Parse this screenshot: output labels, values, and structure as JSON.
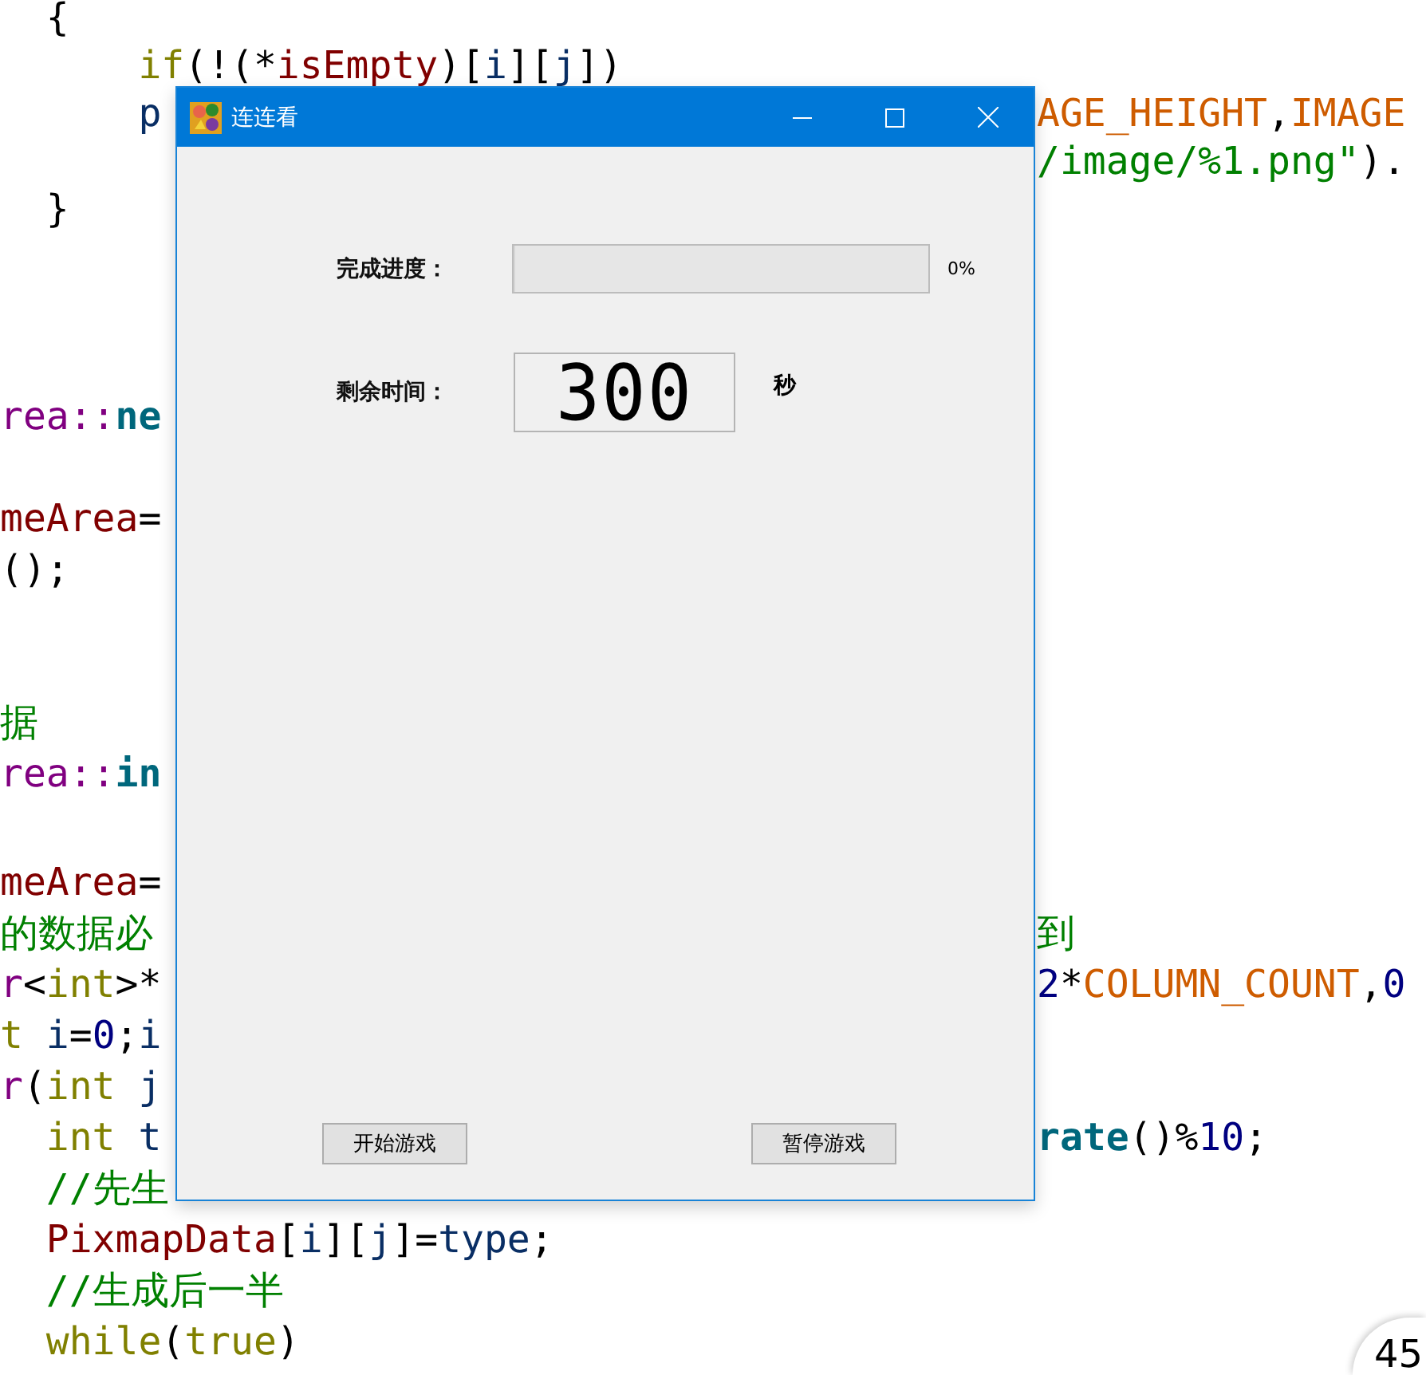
{
  "editor": {
    "blocks": [
      [
        {
          "left": [
            {
              "kind": "punct",
              "text": "  {"
            }
          ]
        },
        {
          "left": [
            {
              "kind": "keyword",
              "text": "      if"
            },
            {
              "kind": "punct",
              "text": "(!(*"
            },
            {
              "kind": "member",
              "text": "isEmpty"
            },
            {
              "kind": "punct",
              "text": ")["
            },
            {
              "kind": "local",
              "text": "i"
            },
            {
              "kind": "punct",
              "text": "]["
            },
            {
              "kind": "local",
              "text": "j"
            },
            {
              "kind": "punct",
              "text": "])"
            }
          ]
        },
        {
          "left": [
            {
              "kind": "local",
              "text": "      p"
            }
          ],
          "right": [
            {
              "kind": "macro",
              "text": "AGE_HEIGHT"
            },
            {
              "kind": "punct",
              "text": ","
            },
            {
              "kind": "macro",
              "text": "IMAGE"
            }
          ]
        },
        {
          "right": [
            {
              "kind": "string",
              "text": "/image/%1.png\""
            },
            {
              "kind": "punct",
              "text": ")."
            }
          ]
        },
        {
          "left": [
            {
              "kind": "punct",
              "text": "  }"
            }
          ]
        }
      ],
      [
        {
          "left": [
            {
              "kind": "type",
              "text": "rea::"
            },
            {
              "kind": "function",
              "text": "ne"
            }
          ]
        }
      ],
      [
        {
          "left": [
            {
              "kind": "member",
              "text": "meArea"
            },
            {
              "kind": "punct",
              "text": "="
            }
          ]
        },
        {
          "left": [
            {
              "kind": "punct",
              "text": "();"
            }
          ]
        }
      ],
      [
        {
          "left": [
            {
              "kind": "comment",
              "text": "据"
            }
          ]
        },
        {
          "left": [
            {
              "kind": "type",
              "text": "rea::"
            },
            {
              "kind": "function",
              "text": "in"
            }
          ]
        }
      ],
      [
        {
          "left": [
            {
              "kind": "member",
              "text": "meArea"
            },
            {
              "kind": "punct",
              "text": "="
            }
          ]
        },
        {
          "left": [
            {
              "kind": "comment",
              "text": "的数据必"
            }
          ],
          "right": [
            {
              "kind": "comment",
              "text": "到"
            }
          ]
        },
        {
          "left": [
            {
              "kind": "type",
              "text": "r"
            },
            {
              "kind": "punct",
              "text": "<"
            },
            {
              "kind": "keyword",
              "text": "int"
            },
            {
              "kind": "punct",
              "text": ">*"
            }
          ],
          "right": [
            {
              "kind": "number",
              "text": "2"
            },
            {
              "kind": "punct",
              "text": "*"
            },
            {
              "kind": "macro",
              "text": "COLUMN_COUNT"
            },
            {
              "kind": "punct",
              "text": ","
            },
            {
              "kind": "number",
              "text": "0"
            }
          ]
        },
        {
          "left": [
            {
              "kind": "keyword",
              "text": "t"
            },
            {
              "kind": "local",
              "text": " i"
            },
            {
              "kind": "punct",
              "text": "="
            },
            {
              "kind": "number",
              "text": "0"
            },
            {
              "kind": "punct",
              "text": ";"
            },
            {
              "kind": "local",
              "text": "i"
            }
          ]
        },
        {
          "left": [
            {
              "kind": "type",
              "text": "r"
            },
            {
              "kind": "punct",
              "text": "("
            },
            {
              "kind": "keyword",
              "text": "int"
            },
            {
              "kind": "local",
              "text": " j"
            }
          ]
        },
        {
          "left": [
            {
              "kind": "keyword",
              "text": "  int"
            },
            {
              "kind": "local",
              "text": " t"
            }
          ],
          "right": [
            {
              "kind": "function",
              "text": "rate"
            },
            {
              "kind": "punct",
              "text": "()%"
            },
            {
              "kind": "number",
              "text": "10"
            },
            {
              "kind": "punct",
              "text": ";"
            }
          ]
        },
        {
          "left": [
            {
              "kind": "comment",
              "text": "  //先生"
            }
          ]
        },
        {
          "left": [
            {
              "kind": "member",
              "text": "  PixmapData"
            },
            {
              "kind": "punct",
              "text": "["
            },
            {
              "kind": "local",
              "text": "i"
            },
            {
              "kind": "punct",
              "text": "]["
            },
            {
              "kind": "local",
              "text": "j"
            },
            {
              "kind": "punct",
              "text": "]="
            },
            {
              "kind": "local",
              "text": "type"
            },
            {
              "kind": "punct",
              "text": ";"
            }
          ]
        },
        {
          "left": [
            {
              "kind": "comment",
              "text": "  //生成后一半"
            }
          ]
        },
        {
          "left": [
            {
              "kind": "keyword",
              "text": "  while"
            },
            {
              "kind": "punct",
              "text": "("
            },
            {
              "kind": "keyword",
              "text": "true"
            },
            {
              "kind": "punct",
              "text": ")"
            }
          ]
        }
      ]
    ]
  },
  "window": {
    "title": "连连看",
    "progress": {
      "label": "完成进度：",
      "level": 0,
      "reading": "0%"
    },
    "timer": {
      "label": "剩余时间：",
      "value": "300",
      "unit": "秒"
    },
    "buttons": [
      "开始游戏",
      "暂停游戏"
    ]
  },
  "speed_widget": {
    "value": "45"
  }
}
